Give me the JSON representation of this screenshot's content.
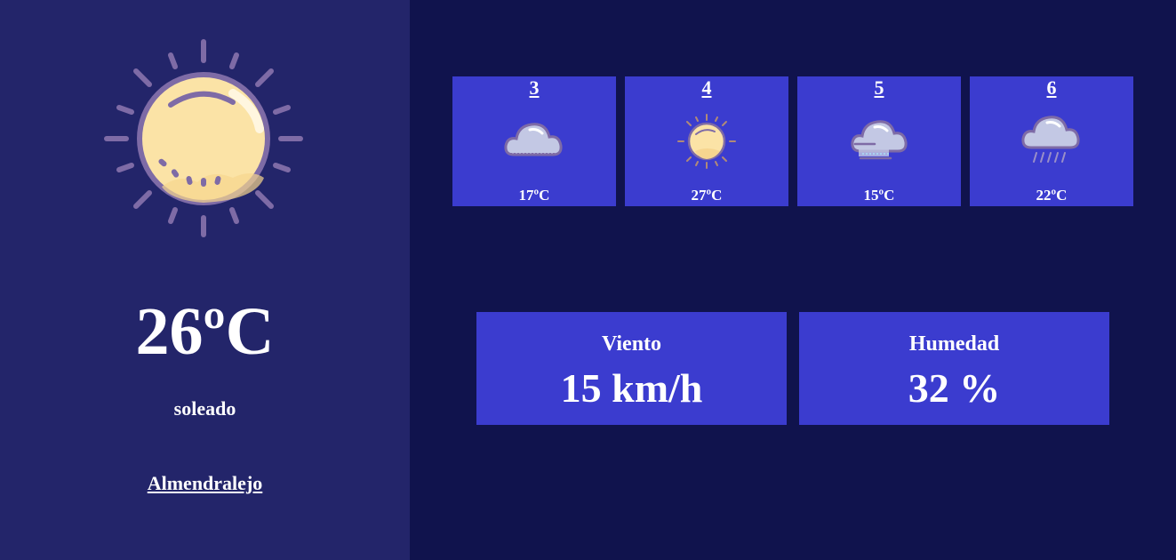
{
  "current": {
    "icon": "sun-icon",
    "temperature": "26ºC",
    "condition": "soleado",
    "city": "Almendralejo"
  },
  "forecast": [
    {
      "day": "3",
      "icon": "cloud-icon",
      "temp": "17ºC"
    },
    {
      "day": "4",
      "icon": "sun-icon",
      "temp": "27ºC"
    },
    {
      "day": "5",
      "icon": "fog-cloud-icon",
      "temp": "15ºC"
    },
    {
      "day": "6",
      "icon": "rain-cloud-icon",
      "temp": "22ºC"
    }
  ],
  "stats": {
    "wind": {
      "label": "Viento",
      "value": "15 km/h"
    },
    "humidity": {
      "label": "Humedad",
      "value": "32 %"
    }
  },
  "colors": {
    "sidebar_bg": "#23256a",
    "main_bg": "#10134d",
    "card_bg": "#3b3ccf",
    "sun_fill": "#fbe3a6",
    "outline": "#7e6ba6"
  }
}
